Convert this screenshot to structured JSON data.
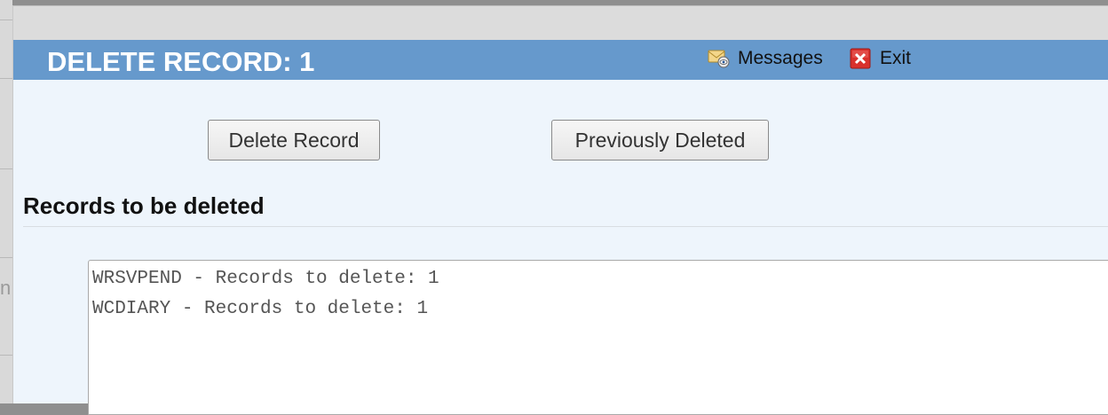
{
  "header": {
    "title": "DELETE RECORD: 1",
    "messages_label": "Messages",
    "exit_label": "Exit"
  },
  "buttons": {
    "delete_record": "Delete Record",
    "previously_deleted": "Previously Deleted"
  },
  "section": {
    "title": "Records to be deleted"
  },
  "records": [
    "WRSVPEND - Records to delete: 1",
    "WCDIARY - Records to delete: 1"
  ],
  "background_window": {
    "glyph": "n"
  },
  "colors": {
    "header_bg": "#6699cc",
    "content_bg": "#eef5fc",
    "exit_icon": "#d9302c"
  },
  "icons": {
    "messages": "messages-envelope-icon",
    "exit": "close-x-icon"
  }
}
